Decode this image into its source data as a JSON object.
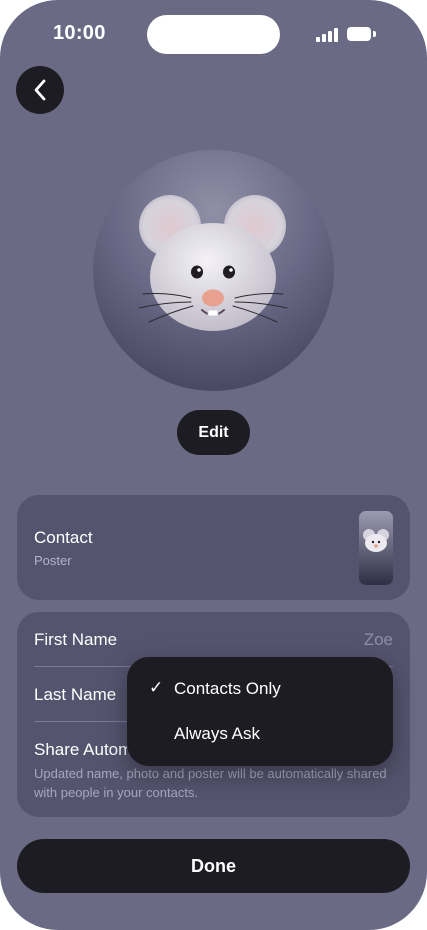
{
  "status_bar": {
    "time": "10:00"
  },
  "profile": {
    "edit_label": "Edit"
  },
  "poster": {
    "title": "Contact",
    "subtitle": "Poster"
  },
  "fields": {
    "first_name_label": "First Name",
    "first_name_value": "Zoe",
    "last_name_label": "Last Name",
    "share_label": "Share Autom",
    "share_note": "Updated name, photo and poster will be automatically shared with people in your contacts."
  },
  "share_menu": {
    "selected": "Contacts Only",
    "options": [
      {
        "label": "Contacts Only",
        "checked": true,
        "check": "✓"
      },
      {
        "label": "Always Ask",
        "checked": false,
        "check": ""
      }
    ]
  },
  "footer": {
    "done_label": "Done"
  },
  "icons": {
    "back": "chevron-left-icon",
    "avatar": "mouse-memoji-icon",
    "signal": "cellular-signal-icon",
    "battery": "battery-icon"
  },
  "colors": {
    "background": "#6b6a85",
    "card": "#55546f",
    "button": "#1c1c22",
    "text_primary": "#ffffff",
    "text_secondary": "#b4b3c8",
    "placeholder": "#8f8ea6"
  }
}
